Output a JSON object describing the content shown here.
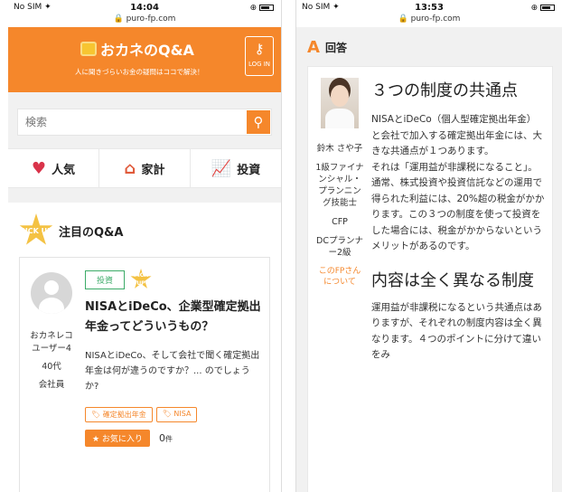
{
  "left_phone": {
    "status": {
      "carrier": "No SIM ✦",
      "time": "14:04",
      "url": "🔒 puro-fp.com"
    },
    "header": {
      "logo_text": "おカネのQ&A",
      "tagline": "人に聞きづらいお金の疑問はココで解決！",
      "login_label": "LOG IN"
    },
    "search": {
      "placeholder": "検索"
    },
    "categories": [
      {
        "label": "人気",
        "icon": "heart-icon"
      },
      {
        "label": "家計",
        "icon": "house-icon"
      },
      {
        "label": "投資",
        "icon": "chart-icon"
      }
    ],
    "pickup": {
      "badge": "PICK UP",
      "title": "注目のQ&A",
      "card": {
        "user": {
          "name": "おカネレコユーザー4",
          "age": "40代",
          "job": "会社員"
        },
        "tag": "投資",
        "small_badge": "PICK UP",
        "question": "NISAとiDeCo、企業型確定拠出年金ってどういうもの？",
        "excerpt": "NISAとiDeCo、そして会社で聞く確定拠出年金は何が違うのですか？... のでしょうか?",
        "keywords": [
          "確定拠出年金",
          "NISA"
        ],
        "fav_label": "★ お気に入り",
        "fav_count": "0",
        "fav_unit": "件"
      }
    }
  },
  "right_phone": {
    "status": {
      "carrier": "No SIM ✦",
      "time": "13:53",
      "url": "🔒 puro-fp.com"
    },
    "answer": {
      "head_letter": "A",
      "head_label": "回答",
      "fp": {
        "name": "鈴木 さや子",
        "title1": "1級ファイナンシャル・プランニング技能士",
        "title2": "CFP",
        "title3": "DCプランナー2級",
        "link": "このFPさんについて"
      },
      "heading1": "３つの制度の共通点",
      "para1": "NISAとiDeCo（個人型確定拠出年金）と会社で加入する確定拠出年金には、大きな共通点が１つあります。",
      "para2": "それは「運用益が非課税になること」。通常、株式投資や投資信託などの運用で得られた利益には、20%超の税金がかかります。この３つの制度を使って投資をした場合には、税金がかからないというメリットがあるのです。",
      "heading2": "内容は全く異なる制度",
      "para3": "運用益が非課税になるという共通点はありますが、それぞれの制度内容は全く異なります。４つのポイントに分けて違いをみ"
    }
  }
}
